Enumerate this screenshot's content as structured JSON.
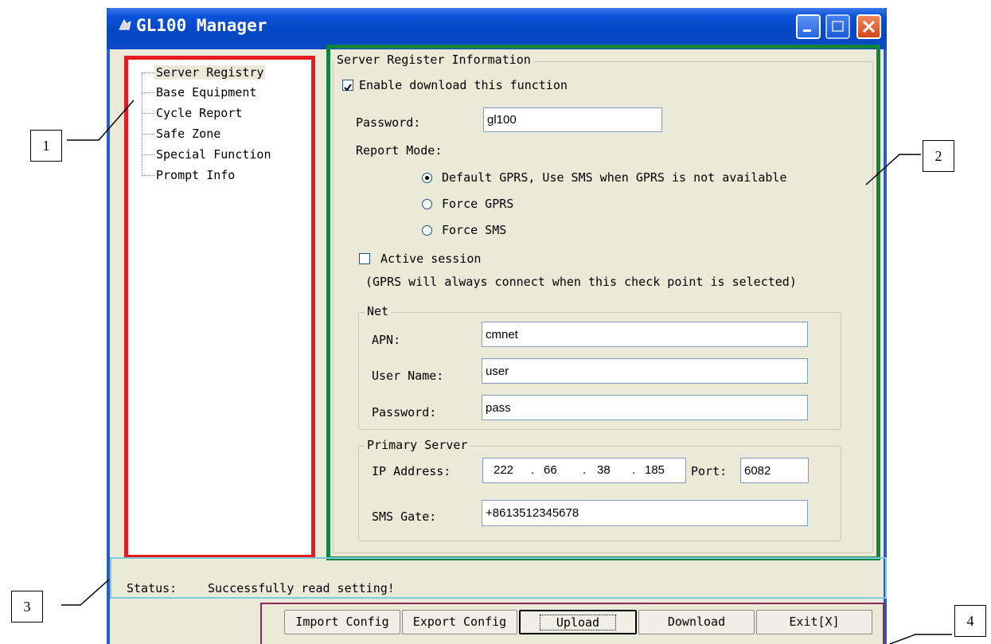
{
  "window": {
    "title": "GL100 Manager"
  },
  "tree": {
    "items": [
      {
        "label": "Server Registry",
        "selected": true
      },
      {
        "label": "Base Equipment"
      },
      {
        "label": "Cycle Report"
      },
      {
        "label": "Safe Zone"
      },
      {
        "label": "Special Function"
      },
      {
        "label": "Prompt Info"
      }
    ]
  },
  "form": {
    "group_title": "Server Register Information",
    "enable_label": "Enable download this function",
    "enable_checked": true,
    "password_label": "Password:",
    "password_value": "gl100",
    "report_mode_label": "Report Mode:",
    "report_modes": [
      {
        "label": "Default GPRS, Use SMS when GPRS is not available",
        "selected": true
      },
      {
        "label": "Force GPRS"
      },
      {
        "label": "Force SMS"
      }
    ],
    "active_session_label": "Active session",
    "active_session_checked": false,
    "active_session_note": "(GPRS will always connect when this check point is selected)",
    "net": {
      "title": "Net",
      "apn_label": "APN:",
      "apn_value": "cmnet",
      "user_label": "User Name:",
      "user_value": "user",
      "password_label": "Password:",
      "password_value": "pass"
    },
    "primary_server": {
      "title": "Primary Server",
      "ip_label": "IP Address:",
      "ip_octets": [
        "222",
        "66",
        "38",
        "185"
      ],
      "port_label": "Port:",
      "port_value": "6082",
      "sms_label": "SMS Gate:",
      "sms_value": "+8613512345678"
    }
  },
  "status": {
    "label": "Status:",
    "text": "Successfully read setting!"
  },
  "buttons": {
    "import": "Import Config",
    "export": "Export Config",
    "upload": "Upload",
    "download": "Download",
    "exit": "Exit[X]"
  },
  "callouts": [
    "1",
    "2",
    "3",
    "4"
  ],
  "colors": {
    "tree_highlight": "#e21c21",
    "form_highlight": "#12843e",
    "status_highlight": "#7ecbe0",
    "buttons_highlight": "#8a2a5a",
    "titlebar": "#0a52d8"
  }
}
